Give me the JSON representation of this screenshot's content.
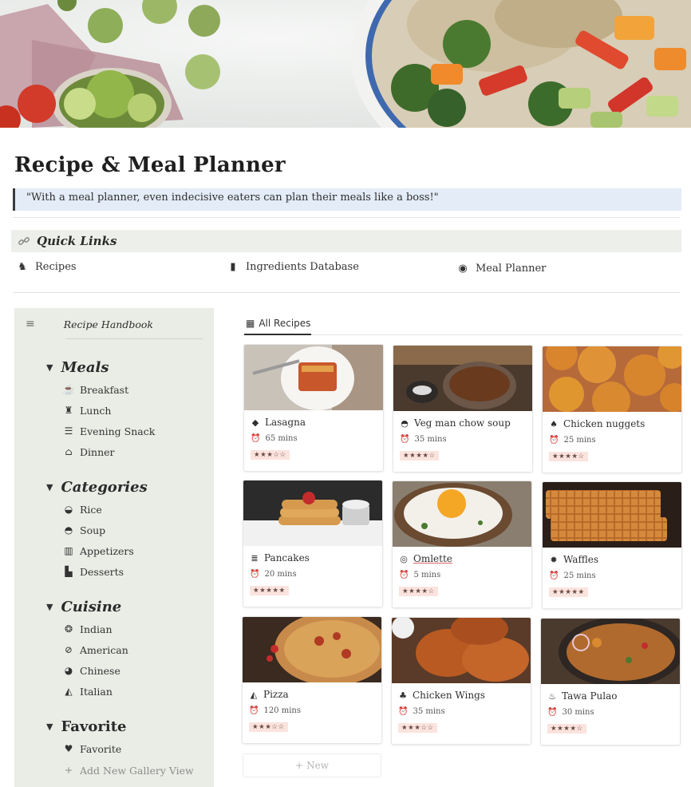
{
  "page": {
    "title": "Recipe & Meal Planner",
    "quote": "\"With a meal planner, even indecisive eaters can plan their meals like a boss!\""
  },
  "quick_links": {
    "title": "Quick Links",
    "icon": "link-icon",
    "links": [
      {
        "label": "Recipes",
        "icon": "chef-icon"
      },
      {
        "label": "Ingredients Database",
        "icon": "book-icon"
      },
      {
        "label": "Meal Planner",
        "icon": "clock-icon"
      }
    ]
  },
  "sidebar": {
    "title": "Recipe Handbook",
    "sections": [
      {
        "label": "Meals",
        "items": [
          {
            "label": "Breakfast",
            "icon": "coffee-icon"
          },
          {
            "label": "Lunch",
            "icon": "chef-icon"
          },
          {
            "label": "Evening Snack",
            "icon": "sandwich-icon"
          },
          {
            "label": "Dinner",
            "icon": "cloche-icon"
          }
        ]
      },
      {
        "label": "Categories",
        "items": [
          {
            "label": "Rice",
            "icon": "rice-bowl-icon"
          },
          {
            "label": "Soup",
            "icon": "soup-icon"
          },
          {
            "label": "Appetizers",
            "icon": "appetizer-icon"
          },
          {
            "label": "Desserts",
            "icon": "cake-icon"
          }
        ]
      },
      {
        "label": "Cuisine",
        "items": [
          {
            "label": "Indian",
            "icon": "indian-icon"
          },
          {
            "label": "American",
            "icon": "hotdog-icon"
          },
          {
            "label": "Chinese",
            "icon": "noodle-icon"
          },
          {
            "label": "Italian",
            "icon": "pizza-icon"
          }
        ]
      },
      {
        "label": "Favorite",
        "items": [
          {
            "label": "Favorite",
            "icon": "heart-icon"
          }
        ]
      }
    ],
    "add_view": "Add New Gallery View"
  },
  "gallery": {
    "tab": "All Recipes",
    "new_label": "New",
    "cards": [
      {
        "name": "Lasagna",
        "time": "65 mins",
        "stars": "★★★☆☆",
        "icon": "lasagna-icon"
      },
      {
        "name": "Veg man chow soup",
        "time": "35 mins",
        "stars": "★★★★☆",
        "icon": "soup-icon"
      },
      {
        "name": "Chicken nuggets",
        "time": "25 mins",
        "stars": "★★★★☆",
        "icon": "drumstick-icon"
      },
      {
        "name": "Pancakes",
        "time": "20 mins",
        "stars": "★★★★★",
        "icon": "pancake-icon"
      },
      {
        "name": "Omlette",
        "time": "5 mins",
        "stars": "★★★★☆",
        "icon": "egg-icon"
      },
      {
        "name": "Waffles",
        "time": "25 mins",
        "stars": "★★★★★",
        "icon": "waffle-icon"
      },
      {
        "name": "Pizza",
        "time": "120 mins",
        "stars": "★★★☆☆",
        "icon": "pizza-icon"
      },
      {
        "name": "Chicken Wings",
        "time": "35 mins",
        "stars": "★★★☆☆",
        "icon": "wing-icon"
      },
      {
        "name": "Tawa Pulao",
        "time": "30 mins",
        "stars": "★★★★☆",
        "icon": "pan-icon"
      }
    ]
  },
  "colors": {
    "quote_bg": "#e3ecf7",
    "quick_links_bg": "#edf0ea",
    "sidebar_bg": "#e9ede6",
    "star_badge_bg": "#fbe3de",
    "clock_color": "#e07a3f"
  }
}
